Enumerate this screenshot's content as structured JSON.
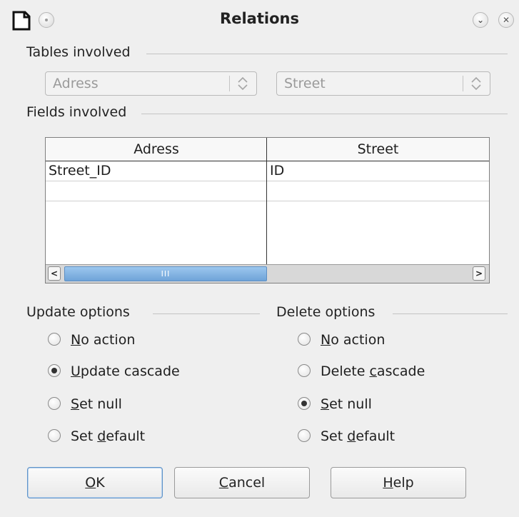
{
  "window": {
    "title": "Relations",
    "icon": "document-icon",
    "pin_icon": "pin-icon",
    "minimize_icon": "chevron-down-icon",
    "close_icon": "close-icon"
  },
  "tables": {
    "header": "Tables involved",
    "left_table": "Adress",
    "right_table": "Street"
  },
  "fields": {
    "header": "Fields involved",
    "columns": [
      "Adress",
      "Street"
    ],
    "rows": [
      [
        "Street_ID",
        "ID"
      ],
      [
        "",
        ""
      ]
    ],
    "scroll_left_icon": "chevron-left-icon",
    "scroll_right_icon": "chevron-right-icon",
    "scroll_thumb_grip": "III"
  },
  "update_options": {
    "header": "Update options",
    "items": [
      {
        "u": "N",
        "rest": "o action",
        "pre": "",
        "selected": false
      },
      {
        "u": "U",
        "rest": "pdate cascade",
        "pre": "",
        "selected": true
      },
      {
        "u": "S",
        "rest": "et null",
        "pre": "",
        "selected": false
      },
      {
        "u": "d",
        "rest": "efault",
        "pre": "Set ",
        "selected": false
      }
    ]
  },
  "delete_options": {
    "header": "Delete options",
    "items": [
      {
        "u": "N",
        "rest": "o action",
        "pre": "",
        "selected": false
      },
      {
        "u": "c",
        "rest": "ascade",
        "pre": "Delete ",
        "selected": false
      },
      {
        "u": "S",
        "rest": "et null",
        "pre": "",
        "selected": true
      },
      {
        "u": "d",
        "rest": "efault",
        "pre": "Set ",
        "selected": false
      }
    ]
  },
  "buttons": {
    "ok": {
      "u": "O",
      "rest": "K"
    },
    "cancel": {
      "u": "C",
      "rest": "ancel"
    },
    "help": {
      "u": "H",
      "rest": "elp"
    }
  },
  "colors": {
    "background": "#efefef",
    "accent": "#6fa3d8",
    "default_button_border": "#5f93c8"
  }
}
